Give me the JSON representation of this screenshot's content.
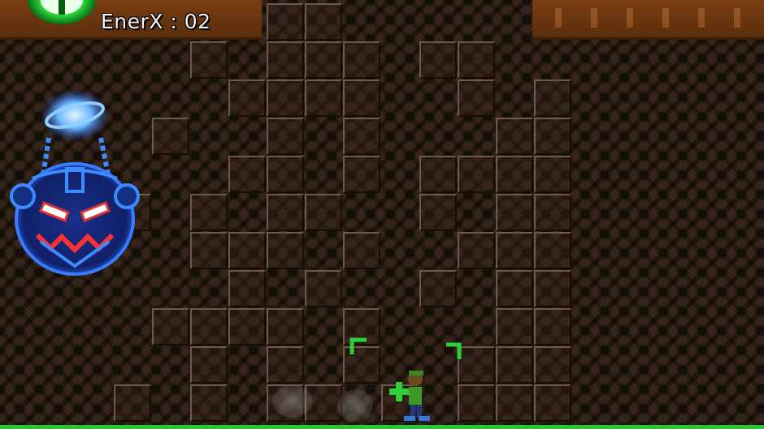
{
  "hud": {
    "energy_label": "EnerX",
    "energy_separator": " : ",
    "energy_count": "02",
    "energy_icon": "green-energy-orb-icon"
  },
  "colors": {
    "hud_bar": "#6a3410",
    "ground": "#2fc33a",
    "boss_glow": "#2a6cff",
    "target_bracket": "#2fd13a"
  },
  "entities": {
    "boss": "blue-robot-boss",
    "player": "player-character",
    "targeting": "green-target-reticle"
  }
}
